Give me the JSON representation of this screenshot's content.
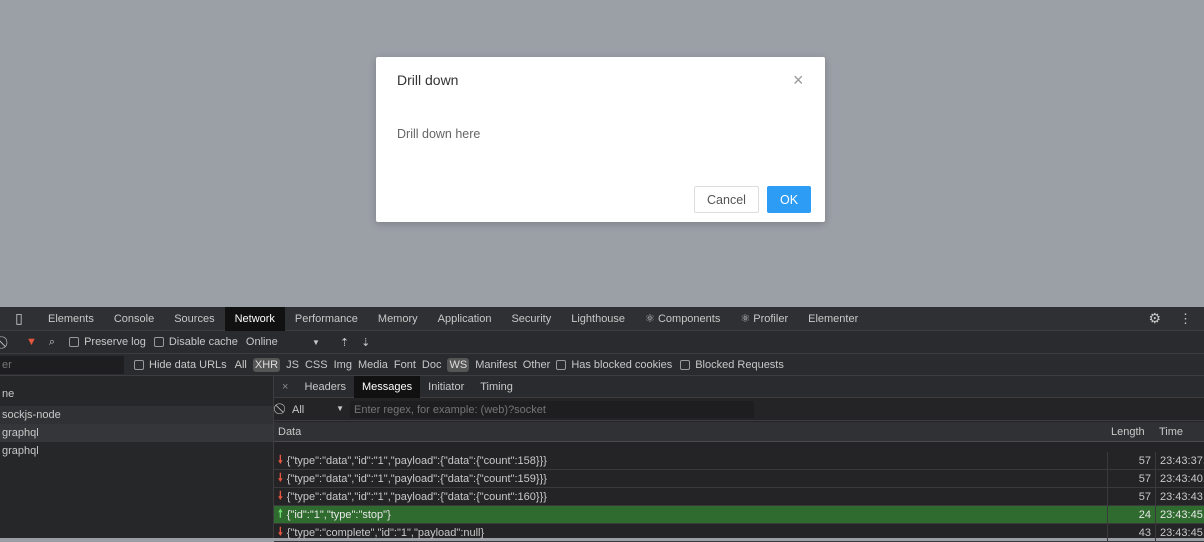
{
  "modal": {
    "title": "Drill down",
    "body": "Drill down here",
    "cancel": "Cancel",
    "ok": "OK",
    "close": "×"
  },
  "devtools": {
    "tabs": [
      "Elements",
      "Console",
      "Sources",
      "Network",
      "Performance",
      "Memory",
      "Application",
      "Security",
      "Lighthouse",
      "⚛ Components",
      "⚛ Profiler",
      "Elementer"
    ],
    "active_tab": "Network",
    "toolbar": {
      "preserve_log": "Preserve log",
      "disable_cache": "Disable cache",
      "throttle": "Online"
    },
    "filter": {
      "placeholder": "er",
      "hide_data_urls": "Hide data URLs",
      "types": [
        "All",
        "XHR",
        "JS",
        "CSS",
        "Img",
        "Media",
        "Font",
        "Doc",
        "WS",
        "Manifest",
        "Other"
      ],
      "active_types": [
        "XHR",
        "WS"
      ],
      "has_blocked_cookies": "Has blocked cookies",
      "blocked_requests": "Blocked Requests"
    },
    "requests": {
      "header": "ne",
      "items": [
        "sockjs-node",
        "graphql",
        "graphql"
      ]
    },
    "detail": {
      "tabs": [
        "Headers",
        "Messages",
        "Initiator",
        "Timing"
      ],
      "active_tab": "Messages",
      "msg_filter": "All",
      "regex_placeholder": "Enter regex, for example: (web)?socket",
      "columns": [
        "Data",
        "Length",
        "Time"
      ],
      "messages": [
        {
          "dir": "received",
          "data": "{\"type\":\"data\",\"id\":\"1\",\"payload\":{\"data\":{\"count\":158}}}",
          "length": "57",
          "time": "23:43:37."
        },
        {
          "dir": "received",
          "data": "{\"type\":\"data\",\"id\":\"1\",\"payload\":{\"data\":{\"count\":159}}}",
          "length": "57",
          "time": "23:43:40."
        },
        {
          "dir": "received",
          "data": "{\"type\":\"data\",\"id\":\"1\",\"payload\":{\"data\":{\"count\":160}}}",
          "length": "57",
          "time": "23:43:43."
        },
        {
          "dir": "sent",
          "data": "{\"id\":\"1\",\"type\":\"stop\"}",
          "length": "24",
          "time": "23:43:45."
        },
        {
          "dir": "received",
          "data": "{\"type\":\"complete\",\"id\":\"1\",\"payload\":null}",
          "length": "43",
          "time": "23:43:45."
        }
      ]
    }
  },
  "colors": {
    "received_arrow": "#e8553e",
    "sent_arrow": "#6fdc6f",
    "sent_bg": "#2f6a2f",
    "ok_button": "#2d9cf5"
  }
}
